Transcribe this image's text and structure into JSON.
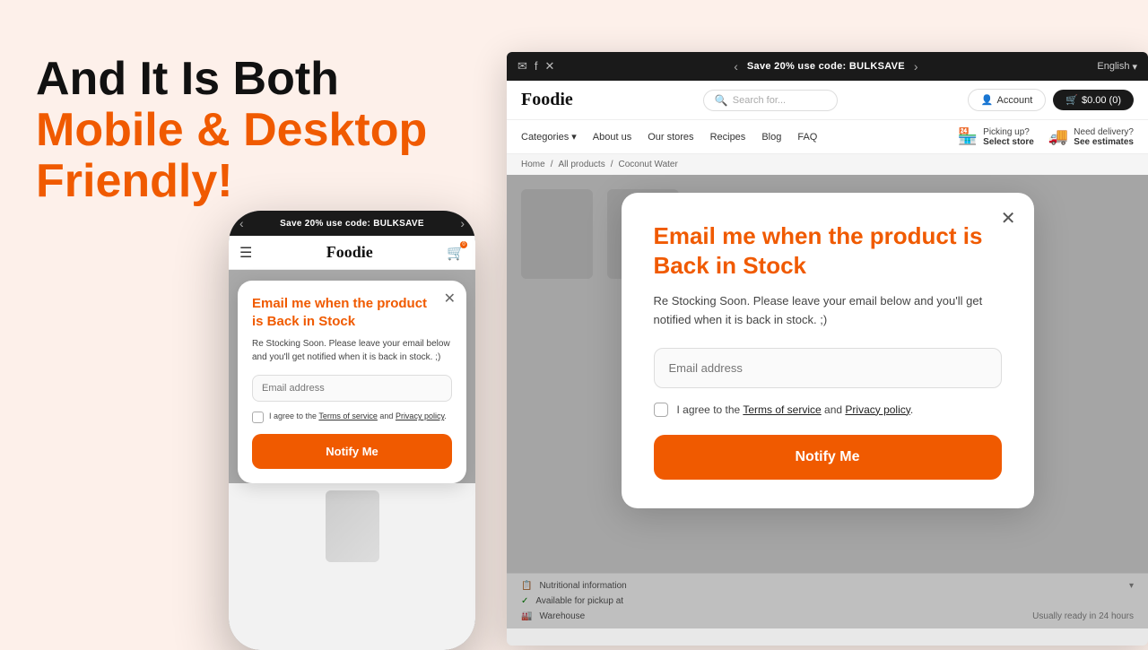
{
  "left": {
    "headline_line1": "And It Is Both",
    "headline_line2": "Mobile & Desktop",
    "headline_line3": "Friendly!"
  },
  "promo_banner": {
    "text": "Save 20% use code: BULKSAVE",
    "arrows_left": "‹",
    "arrows_right": "›"
  },
  "brand": {
    "name": "Foodie"
  },
  "mobile_modal": {
    "title": "Email me when the product is Back in Stock",
    "description": "Re Stocking Soon. Please leave your email below and you'll get notified when it is back in stock. ;)",
    "email_placeholder": "Email address",
    "checkbox_label_pre": "I agree to the ",
    "terms_label": "Terms of service",
    "and_text": " and ",
    "privacy_label": "Privacy policy",
    "period": ".",
    "notify_button": "Notify Me"
  },
  "desktop_modal": {
    "title": "Email me when the product is Back in Stock",
    "description": "Re Stocking Soon. Please leave your email below and you'll get notified when it is back in stock. ;)",
    "email_placeholder": "Email address",
    "checkbox_label_pre": "I agree to the ",
    "terms_label": "Terms of service",
    "and_text": " and ",
    "privacy_label": "Privacy policy",
    "period": ".",
    "notify_button": "Notify Me"
  },
  "desktop_nav": {
    "search_placeholder": "Search for...",
    "account_label": "Account",
    "cart_label": "$0.00 (0)"
  },
  "desktop_secondary_nav": {
    "categories": "Categories",
    "about_us": "About us",
    "our_stores": "Our stores",
    "recipes": "Recipes",
    "blog": "Blog",
    "faq": "FAQ",
    "pickup_label": "Picking up?",
    "pickup_sub": "Select store",
    "delivery_label": "Need delivery?",
    "delivery_sub": "See estimates"
  },
  "breadcrumb": {
    "home": "Home",
    "sep1": "/",
    "all_products": "All products",
    "sep2": "/",
    "current": "Coconut Water"
  },
  "bottom_bar": {
    "nutrition_label": "Nutritional information",
    "pickup_label": "Available for pickup at",
    "warehouse_label": "Warehouse",
    "warehouse_sub": "Usually ready in 24 hours"
  },
  "topbar": {
    "lang": "English"
  }
}
